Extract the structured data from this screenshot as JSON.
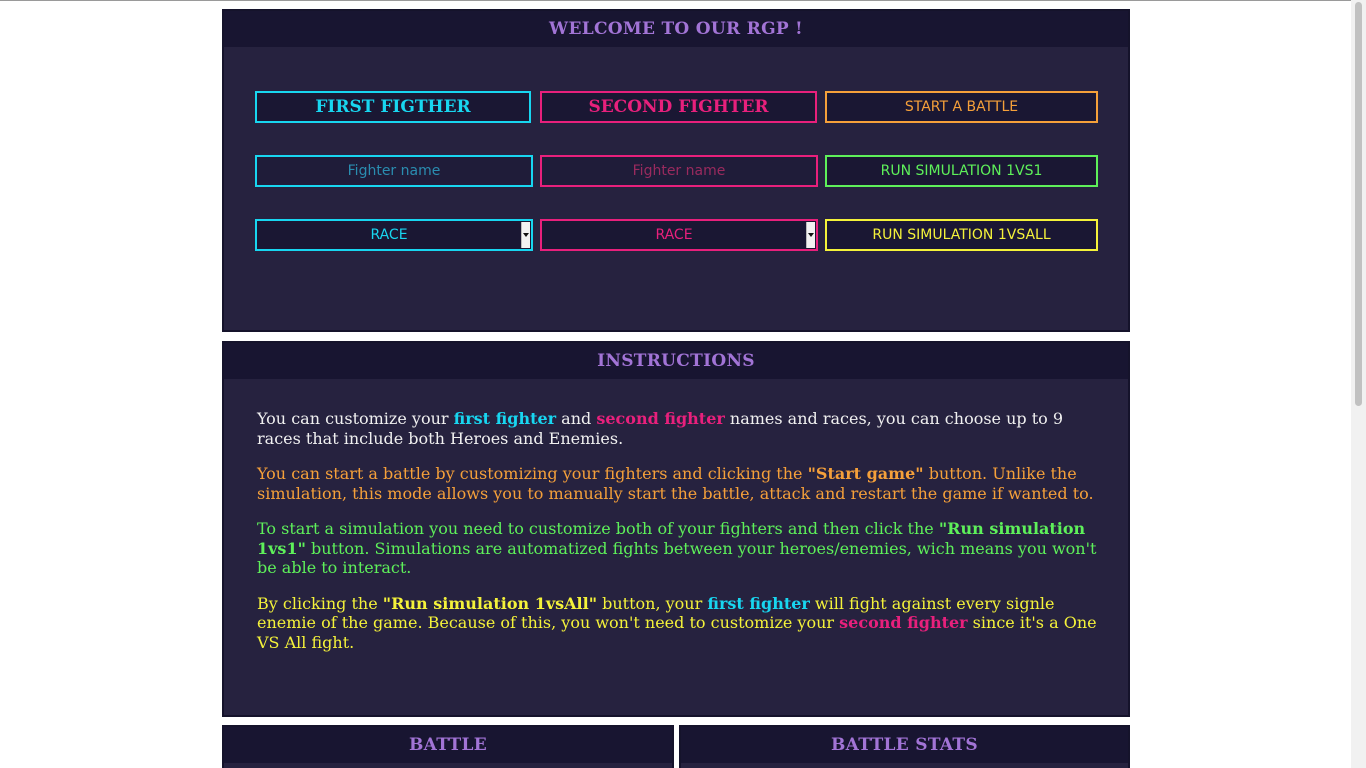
{
  "welcome": {
    "title": "WELCOME TO OUR RGP !",
    "first_fighter_label": "FIRST FIGTHER",
    "second_fighter_label": "SECOND FIGHTER",
    "start_battle": "START A BATTLE",
    "fighter1_name_placeholder": "Fighter name",
    "fighter2_name_placeholder": "Fighter name",
    "run_1vs1": "RUN SIMULATION 1VS1",
    "race1": "RACE",
    "race2": "RACE",
    "run_1vsall": "RUN SIMULATION 1VSALL"
  },
  "instructions": {
    "title": "INSTRUCTIONS",
    "p1": {
      "a": "You can customize your ",
      "first_fighter": "first fighter",
      "b": " and ",
      "second_fighter": "second fighter",
      "c": " names and races, you can choose up to 9 races that include both Heroes and Enemies."
    },
    "p2": {
      "a": "You can start a battle by customizing your fighters and clicking the ",
      "start_game": "\"Start game\"",
      "b": " button. Unlike the simulation, this mode allows you to manually start the battle, attack and restart the game if wanted to."
    },
    "p3": {
      "a": "To start a simulation you need to customize both of your fighters and then click the ",
      "run_1vs1": "\"Run simulation 1vs1\"",
      "b": " button. Simulations are automatized fights between your heroes/enemies, wich means you won't be able to interact."
    },
    "p4": {
      "a": "By clicking the ",
      "run_1vsall": "\"Run simulation 1vsAll\"",
      "b": " button, your ",
      "first_fighter": "first fighter",
      "c": " will fight against every signle enemie of the game. Because of this, you won't need to customize your ",
      "second_fighter": "second fighter",
      "d": " since it's a One VS All fight."
    }
  },
  "battle": {
    "title": "BATTLE"
  },
  "stats": {
    "title": "BATTLE STATS"
  },
  "colors": {
    "cyan": "#18d6f0",
    "pink": "#e8207c",
    "orange": "#f5a03a",
    "green": "#5ef05a",
    "yellow": "#f4f23a",
    "heading": "#a274d6",
    "panel": "#26223f"
  }
}
